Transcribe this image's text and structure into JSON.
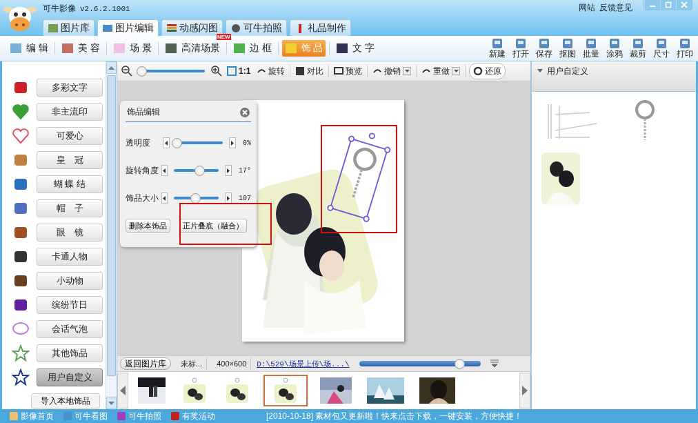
{
  "window": {
    "title": "可牛影像",
    "version": "v2.6.2.1001",
    "links": [
      "网站",
      "反馈意见"
    ]
  },
  "main_tabs": [
    {
      "label": "图片库",
      "selected": false
    },
    {
      "label": "图片编辑",
      "selected": true
    },
    {
      "label": "动感闪图",
      "selected": false
    },
    {
      "label": "可牛拍照",
      "selected": false
    },
    {
      "label": "礼品制作",
      "selected": false
    }
  ],
  "sub_tabs": [
    {
      "label": "编 辑",
      "selected": false
    },
    {
      "label": "美 容",
      "selected": false
    },
    {
      "label": "场 景",
      "selected": false
    },
    {
      "label": "高清场景",
      "selected": false,
      "badge": "NEW"
    },
    {
      "label": "边 框",
      "selected": false
    },
    {
      "label": "饰 品",
      "selected": true
    },
    {
      "label": "文 字",
      "selected": false
    }
  ],
  "actions": [
    "新建",
    "打开",
    "保存",
    "抠图",
    "批量",
    "涂鸦",
    "裁剪",
    "尺寸",
    "打印"
  ],
  "sidebar": {
    "items": [
      {
        "label": "多彩文字",
        "selected": false
      },
      {
        "label": "非主流印",
        "selected": false
      },
      {
        "label": "可爱心",
        "selected": false
      },
      {
        "label": "皇　冠",
        "selected": false
      },
      {
        "label": "蝴 蝶 结",
        "selected": false
      },
      {
        "label": "帽　子",
        "selected": false
      },
      {
        "label": "眼　镜",
        "selected": false
      },
      {
        "label": "卡通人物",
        "selected": false
      },
      {
        "label": "小动物",
        "selected": false
      },
      {
        "label": "缤纷节日",
        "selected": false
      },
      {
        "label": "会话气泡",
        "selected": false
      },
      {
        "label": "其他饰品",
        "selected": false
      },
      {
        "label": "用户自定义",
        "selected": true
      }
    ],
    "import_button": "导入本地饰品"
  },
  "view_toolbar": {
    "zoom_slider": {
      "level": 0.03
    },
    "buttons": [
      "1:1",
      "旋转",
      "对比",
      "预览",
      "撤销",
      "重做",
      "还原"
    ]
  },
  "edit_panel": {
    "title": "饰品编辑",
    "sliders": [
      {
        "label": "透明度",
        "level": 0.0,
        "reading": "0%"
      },
      {
        "label": "旋转角度",
        "level": 0.55,
        "reading": "17°"
      },
      {
        "label": "饰品大小",
        "level": 0.46,
        "reading": "107"
      }
    ],
    "buttons": [
      "删除本饰品",
      "正片叠底（融合）"
    ]
  },
  "info_bar": {
    "back_button": "返回图片库",
    "filename": "未标...",
    "size": "400×600",
    "path": "D:\\529\\场景上传\\场...\\",
    "size_slider": {
      "level": 0.82
    }
  },
  "filmstrip": [
    {
      "kind": "snow",
      "selected": false
    },
    {
      "kind": "keychain",
      "selected": false
    },
    {
      "kind": "keychain",
      "selected": false
    },
    {
      "kind": "keychain",
      "selected": true
    },
    {
      "kind": "pink",
      "selected": false
    },
    {
      "kind": "sea",
      "selected": false
    },
    {
      "kind": "portrait",
      "selected": false
    }
  ],
  "right_panel": {
    "title": "用户自定义"
  },
  "status_bar": {
    "links": [
      "影像首页",
      "可牛看图",
      "可牛拍照",
      "有奖活动"
    ],
    "news": "[2010-10-18] 素材包又更新啦！快来点击下载，一键安装，方便快捷！"
  }
}
